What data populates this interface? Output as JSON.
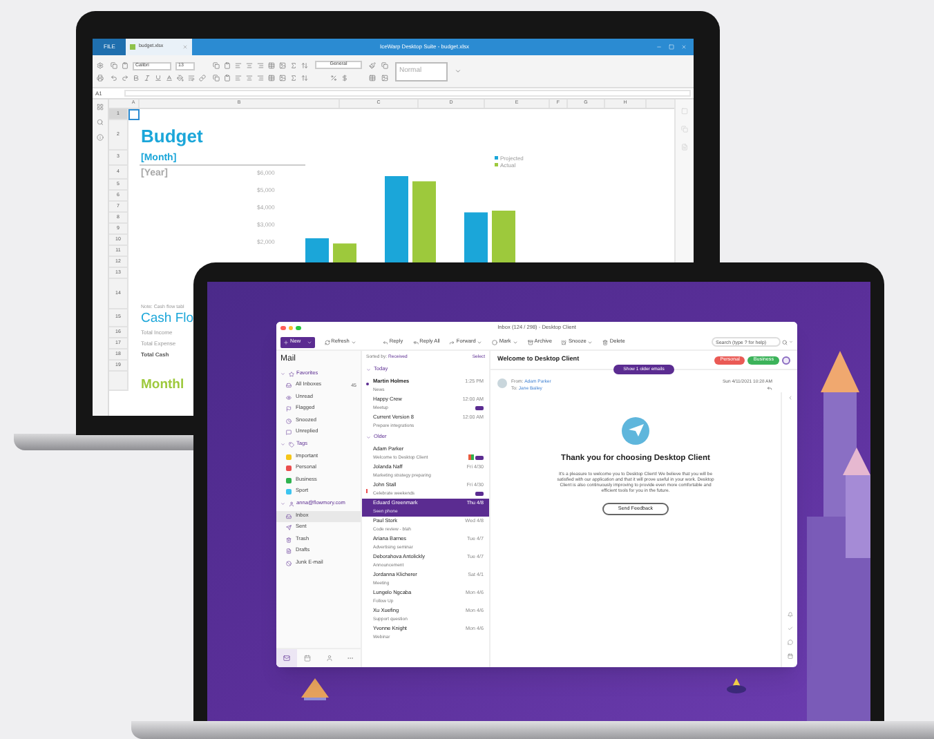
{
  "spreadsheet": {
    "title": "IceWarp Desktop Suite - budget.xlsx",
    "file_tab": "FILE",
    "document_tab": "budget.xlsx",
    "font": "Calibri",
    "font_size": "13",
    "number_format": "General",
    "cell_style": "Normal",
    "cell_ref": "A1",
    "columns": [
      "A",
      "B",
      "C",
      "D",
      "E",
      "F",
      "G",
      "H"
    ],
    "rows": [
      {
        "number": "1",
        "selected": true,
        "kind": "blank"
      },
      {
        "number": "2",
        "selected": false,
        "kind": "title",
        "text": "Budget"
      },
      {
        "number": "3",
        "selected": false,
        "kind": "subtitle",
        "text": "[Month]"
      },
      {
        "number": "4",
        "selected": false,
        "kind": "muted",
        "text": "[Year]"
      },
      {
        "number": "5",
        "selected": false,
        "kind": "blank"
      },
      {
        "number": "6",
        "selected": false,
        "kind": "blank"
      },
      {
        "number": "7",
        "selected": false,
        "kind": "blank"
      },
      {
        "number": "8",
        "selected": false,
        "kind": "blank"
      },
      {
        "number": "9",
        "selected": false,
        "kind": "blank"
      },
      {
        "number": "10",
        "selected": false,
        "kind": "blank"
      },
      {
        "number": "11",
        "selected": false,
        "kind": "blank"
      },
      {
        "number": "12",
        "selected": false,
        "kind": "blank"
      },
      {
        "number": "13",
        "selected": false,
        "kind": "blank"
      },
      {
        "number": "14",
        "selected": false,
        "kind": "note",
        "text": "Note: Cash flow tabl"
      },
      {
        "number": "15",
        "selected": false,
        "kind": "heading",
        "text": "Cash Flo"
      },
      {
        "number": "16",
        "selected": false,
        "kind": "label",
        "text": "Total Income"
      },
      {
        "number": "17",
        "selected": false,
        "kind": "label",
        "text": "Total Expense"
      },
      {
        "number": "18",
        "selected": false,
        "kind": "label_bold",
        "text": "Total Cash"
      },
      {
        "number": "19",
        "selected": false,
        "kind": "blank"
      },
      {
        "kind": "heading_green",
        "text": "Monthl"
      }
    ],
    "chart_data": {
      "type": "bar",
      "legend": true,
      "series": [
        {
          "name": "Projected",
          "color": "#1ba6d9",
          "values": [
            2200,
            5800,
            3700
          ]
        },
        {
          "name": "Actual",
          "color": "#9dc93c",
          "values": [
            1900,
            5500,
            3800
          ]
        }
      ],
      "ylim": [
        0,
        6000
      ],
      "yticks": [
        {
          "value": 2000,
          "label": "$2,000"
        },
        {
          "value": 3000,
          "label": "$3,000"
        },
        {
          "value": 4000,
          "label": "$4,000"
        },
        {
          "value": 5000,
          "label": "$5,000"
        },
        {
          "value": 6000,
          "label": "$6,000"
        }
      ]
    }
  },
  "mail": {
    "title": "Inbox (124 / 298) - Desktop Client",
    "toolbar": [
      {
        "kind": "new",
        "label": "New",
        "dropdown": true
      },
      {
        "kind": "refresh",
        "label": "Refresh",
        "dropdown": true
      },
      {
        "kind": "reply",
        "label": "Reply",
        "dropdown": false
      },
      {
        "kind": "reply_all",
        "label": "Reply All",
        "dropdown": false
      },
      {
        "kind": "forward",
        "label": "Forward",
        "dropdown": true
      },
      {
        "kind": "mark",
        "label": "Mark",
        "dropdown": true
      },
      {
        "kind": "archive",
        "label": "Archive",
        "dropdown": false
      },
      {
        "kind": "snooze",
        "label": "Snooze",
        "dropdown": true
      },
      {
        "kind": "delete",
        "label": "Delete",
        "dropdown": false
      }
    ],
    "search": {
      "placeholder": "Search (type ? for help)"
    },
    "sidebar": {
      "heading": "Mail",
      "sections": [
        {
          "kind": "favorites",
          "label": "Favorites",
          "expanded": true,
          "items": [
            {
              "kind": "all",
              "label": "All Inboxes",
              "count": "45",
              "selected": false
            },
            {
              "kind": "unread",
              "label": "Unread",
              "selected": false
            },
            {
              "kind": "flagged",
              "label": "Flagged",
              "selected": false
            },
            {
              "kind": "snoozed",
              "label": "Snoozed",
              "selected": false
            },
            {
              "kind": "unreplied",
              "label": "Unreplied",
              "selected": false
            }
          ]
        },
        {
          "kind": "tags",
          "label": "Tags",
          "expanded": true,
          "items": [
            {
              "kind": "tag",
              "label": "Important",
              "color": "#f5c518",
              "selected": false
            },
            {
              "kind": "tag",
              "label": "Personal",
              "color": "#ea4d4d",
              "selected": false
            },
            {
              "kind": "tag",
              "label": "Business",
              "color": "#2fb34f",
              "selected": false
            },
            {
              "kind": "tag",
              "label": "Sport",
              "color": "#3cc4f0",
              "selected": false
            }
          ]
        },
        {
          "kind": "account",
          "label": "anna@flowmory.com",
          "expanded": true,
          "items": [
            {
              "kind": "inbox",
              "label": "Inbox",
              "selected": true
            },
            {
              "kind": "sent",
              "label": "Sent",
              "selected": false
            },
            {
              "kind": "trash",
              "label": "Trash",
              "selected": false
            },
            {
              "kind": "drafts",
              "label": "Drafts",
              "selected": false
            },
            {
              "kind": "junk",
              "label": "Junk E-mail",
              "selected": false
            }
          ]
        }
      ]
    },
    "nav": [
      {
        "kind": "mail",
        "selected": true
      },
      {
        "kind": "calendar",
        "selected": false
      },
      {
        "kind": "contacts",
        "selected": false
      },
      {
        "kind": "more",
        "selected": false
      }
    ],
    "list": {
      "sort_label": "Sorted by:",
      "sort_value": "Received",
      "select": "Select",
      "groups": [
        {
          "label": "Today",
          "expanded": true,
          "messages": [
            {
              "sender": "Martin Holmes",
              "subject": "News",
              "time": "1:25 PM",
              "unread": true,
              "flagged": false,
              "thread": false,
              "selected": false
            },
            {
              "sender": "Happy Crew",
              "subject": "Meetup",
              "time": "12:00 AM",
              "unread": false,
              "flagged": false,
              "thread": true,
              "selected": false
            },
            {
              "sender": "Current Version 8",
              "subject": "Prepare integrations",
              "time": "12:00 AM",
              "unread": false,
              "flagged": false,
              "thread": false,
              "selected": false
            }
          ]
        },
        {
          "label": "Older",
          "expanded": true,
          "messages": [
            {
              "sender": "Adam Parker",
              "subject": "Welcome to Desktop Client",
              "unread": false,
              "flagged": false,
              "thread": true,
              "selected": false,
              "tags": [
                {
                  "color": "#ea5a3d"
                },
                {
                  "color": "#2fb34f"
                }
              ]
            },
            {
              "sender": "Jolanda Naff",
              "subject": "Marketing strategy preparing",
              "time": "Fri 4/30",
              "unread": false,
              "flagged": false,
              "thread": false,
              "selected": false
            },
            {
              "sender": "John Stall",
              "subject": "Celebrate weekends",
              "time": "Fri 4/30",
              "unread": false,
              "flagged": true,
              "thread": true,
              "selected": false
            },
            {
              "sender": "Eduard Greenmark",
              "subject": "Seen phone",
              "time": "Thu 4/8",
              "unread": false,
              "flagged": false,
              "thread": false,
              "selected": true
            },
            {
              "sender": "Paul Stork",
              "subject": "Code review - blah",
              "time": "Wed 4/8",
              "unread": false,
              "flagged": false,
              "thread": false,
              "selected": false
            },
            {
              "sender": "Ariana Barnes",
              "subject": "Advertising seminar",
              "time": "Tue 4/7",
              "unread": false,
              "flagged": false,
              "thread": false,
              "selected": false
            },
            {
              "sender": "Deborahova Antolickly",
              "subject": "Announcement",
              "time": "Tue 4/7",
              "unread": false,
              "flagged": false,
              "thread": false,
              "selected": false
            },
            {
              "sender": "Jordanna Klicherer",
              "subject": "Meeting",
              "time": "Sat 4/1",
              "unread": false,
              "flagged": false,
              "thread": false,
              "selected": false
            },
            {
              "sender": "Lungelo Ngcaba",
              "subject": "Follow Up",
              "time": "Mon 4/6",
              "unread": false,
              "flagged": false,
              "thread": false,
              "selected": false
            },
            {
              "sender": "Xu Xuefing",
              "subject": "Support question",
              "time": "Mon 4/6",
              "unread": false,
              "flagged": false,
              "thread": false,
              "selected": false
            },
            {
              "sender": "Yvonne Knight",
              "subject": "Webinar",
              "time": "Mon 4/6",
              "unread": false,
              "flagged": false,
              "thread": false,
              "selected": false
            }
          ]
        }
      ]
    },
    "reading": {
      "subject": "Welcome to Desktop Client",
      "tags": [
        {
          "label": "Personal",
          "color": "#ea5a55"
        },
        {
          "label": "Business",
          "color": "#3cb35a"
        }
      ],
      "older": "Show 1 older emails",
      "from_label": "From:",
      "from": "Adam Parker",
      "to_label": "To:",
      "to": "Jane Bailey",
      "date": "Sun 4/11/2021 10:28 AM",
      "heading": "Thank you for choosing Desktop Client",
      "body": "It's a pleasure to welcome you to Desktop Client! We believe that you will be satisfied with our application and that it will prove useful in your work. Desktop Client is also continuously improving to provide even more comfortable and efficient tools for you in the future.",
      "button": "Send Feedback"
    }
  }
}
